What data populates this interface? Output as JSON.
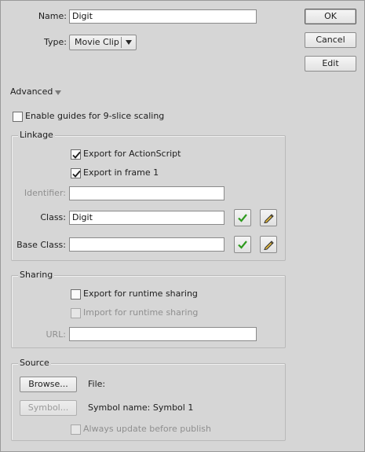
{
  "name_row": {
    "label": "Name:",
    "value": "Digit"
  },
  "type_row": {
    "label": "Type:",
    "selected": "Movie Clip"
  },
  "buttons": {
    "ok": "OK",
    "cancel": "Cancel",
    "edit": "Edit"
  },
  "advanced": {
    "label": "Advanced"
  },
  "guides": {
    "label": "Enable guides for 9-slice scaling",
    "checked": false
  },
  "linkage": {
    "title": "Linkage",
    "export_actionscript": {
      "label": "Export for ActionScript",
      "checked": true
    },
    "export_frame1": {
      "label": "Export in frame 1",
      "checked": true
    },
    "identifier": {
      "label": "Identifier:",
      "value": ""
    },
    "class": {
      "label": "Class:",
      "value": "Digit"
    },
    "base_class": {
      "label": "Base Class:",
      "value": ""
    },
    "icons": {
      "validate": "checkmark-icon",
      "edit": "pencil-icon"
    }
  },
  "sharing": {
    "title": "Sharing",
    "export_runtime": {
      "label": "Export for runtime sharing",
      "checked": false
    },
    "import_runtime": {
      "label": "Import for runtime sharing",
      "checked": false
    },
    "url": {
      "label": "URL:",
      "value": ""
    }
  },
  "source": {
    "title": "Source",
    "browse_button": "Browse...",
    "file_label": "File:",
    "symbol_button": "Symbol...",
    "symbol_name": "Symbol name: Symbol 1",
    "always_update": {
      "label": "Always update before publish",
      "checked": false
    }
  },
  "colors": {
    "background": "#d6d6d6",
    "check_green": "#2e9a1e"
  }
}
